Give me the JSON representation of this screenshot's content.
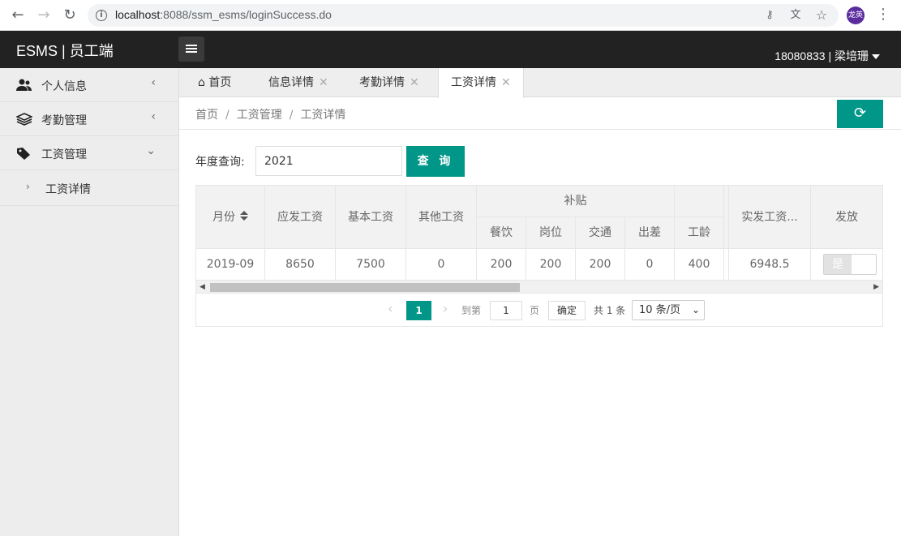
{
  "browser": {
    "url_host": "localhost",
    "url_path": ":8088/ssm_esms/loginSuccess.do",
    "avatar_text": "龙英"
  },
  "header": {
    "title": "ESMS | 员工端",
    "user": "18080833 | 梁培珊"
  },
  "sidebar": {
    "items": [
      {
        "label": "个人信息",
        "icon": "user-group-icon",
        "chevron": "‹"
      },
      {
        "label": "考勤管理",
        "icon": "layers-icon",
        "chevron": "‹"
      },
      {
        "label": "工资管理",
        "icon": "tag-icon",
        "chevron": "⌄"
      }
    ],
    "sub_items": [
      {
        "label": "工资详情"
      }
    ]
  },
  "tabs": [
    {
      "label": "首页",
      "closable": false
    },
    {
      "label": "信息详情",
      "closable": true
    },
    {
      "label": "考勤详情",
      "closable": true
    },
    {
      "label": "工资详情",
      "closable": true,
      "active": true
    }
  ],
  "breadcrumb": [
    "首页",
    "工资管理",
    "工资详情"
  ],
  "query": {
    "label": "年度查询:",
    "value": "2021",
    "button": "查 询"
  },
  "table": {
    "headers": {
      "month": "月份",
      "gross": "应发工资",
      "base": "基本工资",
      "other": "其他工资",
      "subsidy": "补贴",
      "meal": "餐饮",
      "post": "岗位",
      "traffic": "交通",
      "travel": "出差",
      "seniority": "工龄",
      "net": "实发工资...",
      "issued": "发放"
    },
    "rows": [
      {
        "month": "2019-09",
        "gross": "8650",
        "base": "7500",
        "other": "0",
        "meal": "200",
        "post": "200",
        "traffic": "200",
        "travel": "0",
        "seniority": "400",
        "net": "6948.5",
        "issued": "是"
      }
    ]
  },
  "pager": {
    "current": "1",
    "goto_label": "到第",
    "goto_value": "1",
    "page_unit": "页",
    "confirm": "确定",
    "total": "共 1 条",
    "page_size": "10 条/页"
  },
  "colors": {
    "accent": "#009688",
    "header_bg": "#222222",
    "sidebar_bg": "#ededed"
  }
}
